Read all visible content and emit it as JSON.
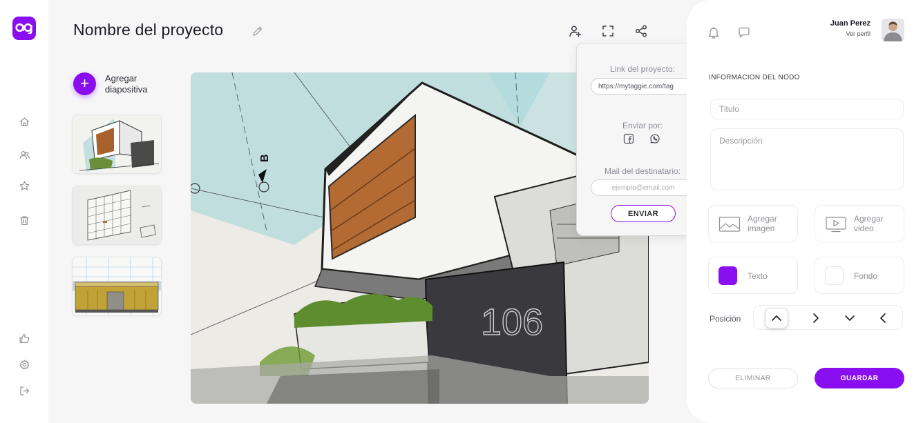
{
  "brand": {
    "accent": "#8a0ff0"
  },
  "sidebar": {
    "items": [
      {
        "icon": "home-icon"
      },
      {
        "icon": "users-icon"
      },
      {
        "icon": "star-icon"
      },
      {
        "icon": "trash-icon"
      },
      {
        "icon": "thumbs-up-icon"
      },
      {
        "icon": "gear-icon"
      },
      {
        "icon": "logout-icon"
      }
    ]
  },
  "header": {
    "project_title": "Nombre del proyecto",
    "actions": [
      "add-user-icon",
      "fullscreen-icon",
      "share-icon"
    ]
  },
  "slides": {
    "add_label": "Agregar diapositiva",
    "add_symbol": "+"
  },
  "share": {
    "link_label": "Link del proyecto:",
    "link_value": "https://mytaggie.com/tag",
    "send_via_label": "Enviar por:",
    "send_via": [
      "facebook-icon",
      "whatsapp-icon"
    ],
    "mail_label": "Mail del destinatario:",
    "mail_placeholder": "ejemplo@email.com",
    "send_button": "ENVIAR"
  },
  "user": {
    "name": "Juan Perez",
    "profile_link": "Ver perfil"
  },
  "node": {
    "section_title": "INFORMACION DEL NODO",
    "title_placeholder": "Titulo",
    "description_placeholder": "Descripción",
    "add_image": "Agregar imagen",
    "add_video": "Agregar video",
    "text_label": "Texto",
    "text_color": "#8a0ff0",
    "background_label": "Fondo",
    "background_color": "#ffffff",
    "position_label": "Posición",
    "position_options": [
      "up",
      "right",
      "down",
      "left"
    ],
    "position_selected": "up",
    "delete_button": "ELIMINAR",
    "save_button": "GUARDAR"
  }
}
